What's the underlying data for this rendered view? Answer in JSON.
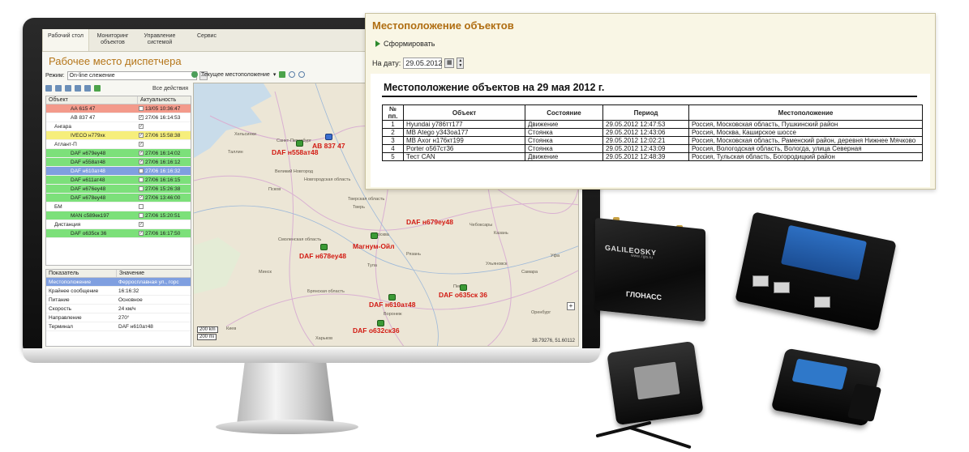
{
  "app": {
    "nav": [
      "Рабочий стол",
      "Мониторинг объектов",
      "Управление системой",
      "Сервис"
    ],
    "title": "Рабочее место диспетчера",
    "mode_label": "Режим:",
    "mode_value": "On-line слежение",
    "map_current_location": "Текущее местоположение",
    "all_actions": "Все действия",
    "tree_columns": [
      "Объект",
      "Актуальность"
    ],
    "tree_rows": [
      {
        "name": "АА 615 47",
        "time": "13/05 10:36:47",
        "checked": "",
        "color": "red"
      },
      {
        "name": "АВ 837 47",
        "time": "27/06 16:14:53",
        "checked": "✓",
        "color": "white"
      },
      {
        "name": "Ангара",
        "time": "",
        "checked": "✓",
        "color": "white"
      },
      {
        "name": "IVECO н779хк",
        "time": "27/06 15:58:38",
        "checked": "✓",
        "color": "yellow"
      },
      {
        "name": "Атлант-П",
        "time": "",
        "checked": "✓",
        "color": "white"
      },
      {
        "name": "DAF н679еу48",
        "time": "27/06 16:14:02",
        "checked": "✓",
        "color": "green"
      },
      {
        "name": "DAF н558ат48",
        "time": "27/06 16:16:12",
        "checked": "✓",
        "color": "green"
      },
      {
        "name": "DAF н610ат48",
        "time": "27/06 16:16:32",
        "checked": "✓",
        "color": "blue"
      },
      {
        "name": "DAF н611ат48",
        "time": "27/06 16:16:15",
        "checked": "",
        "color": "green"
      },
      {
        "name": "DAF н676еу48",
        "time": "27/06 15:26:38",
        "checked": "",
        "color": "green"
      },
      {
        "name": "DAF н678еу48",
        "time": "27/06 13:46:00",
        "checked": "✓",
        "color": "green"
      },
      {
        "name": "БМ",
        "time": "",
        "checked": "",
        "color": "white"
      },
      {
        "name": "MAN с589ек197",
        "time": "27/06 15:20:51",
        "checked": "",
        "color": "green"
      },
      {
        "name": "Дистанция",
        "time": "",
        "checked": "✓",
        "color": "white"
      },
      {
        "name": "DAF о635ск 36",
        "time": "27/06 16:17:50",
        "checked": "✓",
        "color": "green"
      }
    ],
    "props_columns": [
      "Показатель",
      "Значение"
    ],
    "props_rows": [
      {
        "k": "Местоположение",
        "v": "Ферросплавная ул., горс"
      },
      {
        "k": "Крайнее сообщение",
        "v": "16:16:32"
      },
      {
        "k": "Питание",
        "v": "Основное"
      },
      {
        "k": "Скорость",
        "v": "24 км/ч"
      },
      {
        "k": "Направление",
        "v": "270°"
      },
      {
        "k": "Терминал",
        "v": "DAF н610ат48"
      }
    ],
    "map_labels": [
      "DAF н558ат48",
      "АВ 837 47",
      "DAF н679еу48",
      "Магнум-Ойл",
      "DAF н678еу48",
      "DAF о635ск 36",
      "DAF н610ат48",
      "DAF о632ск36"
    ],
    "map_cities": [
      "Хельсинки",
      "Таллин",
      "Санкт-Петербург",
      "Великий Новгород",
      "Псков",
      "Тверь",
      "Москва",
      "Рязань",
      "Тула",
      "Минск",
      "Воронеж",
      "Самара",
      "Ульяновск",
      "Уфа",
      "Казань",
      "Чебоксары",
      "Пенза",
      "Оренбург",
      "Киев",
      "Харьков",
      "Новгородская область",
      "Тверская область",
      "Смоленская область",
      "Брянская область"
    ],
    "scale_km": "200 km",
    "scale_mi": "200 mi",
    "coords": "38.79276, 51.60112"
  },
  "report": {
    "title": "Местоположение объектов",
    "form_button": "Сформировать",
    "date_label": "На дату:",
    "date_value": "29.05.2012",
    "sheet_title": "Местоположение объектов на 29 мая 2012 г.",
    "columns": [
      "№ пп.",
      "Объект",
      "Состояние",
      "Период",
      "Местоположение"
    ],
    "rows": [
      {
        "n": "1",
        "obj": "Hyundai у786тт177",
        "state": "Движение",
        "period": "29.05.2012 12:47:53",
        "loc": "Россия, Московская область, Пушкинский район"
      },
      {
        "n": "2",
        "obj": "MB Atego у343оа177",
        "state": "Стоянка",
        "period": "29.05.2012 12:43:06",
        "loc": "Россия, Москва, Каширское шоссе"
      },
      {
        "n": "3",
        "obj": "MB Axor н176кт199",
        "state": "Стоянка",
        "period": "29.05.2012 12:02:21",
        "loc": "Россия, Московская область, Раменский район, деревня Нижнее Мячково"
      },
      {
        "n": "4",
        "obj": "Porter о567ст36",
        "state": "Стоянка",
        "period": "29.05.2012 12:43:09",
        "loc": "Россия, Вологодская область, Вологда, улица Северная"
      },
      {
        "n": "5",
        "obj": "Тест CAN",
        "state": "Движение",
        "period": "29.05.2012 12:48:39",
        "loc": "Россия, Тульская область, Богородицкий район"
      }
    ]
  },
  "devices": {
    "galileo_brand": "GALILEOSKY",
    "galileo_sub": "www.7gis.ru",
    "galileo_label": "ГЛОНАСС"
  }
}
